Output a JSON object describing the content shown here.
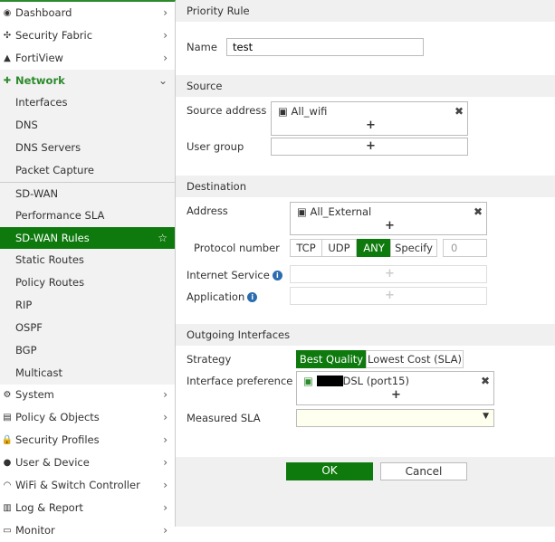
{
  "sidebar": {
    "items": [
      {
        "label": "Dashboard",
        "icon": "dashboard-icon",
        "chevron": "›"
      },
      {
        "label": "Security Fabric",
        "icon": "security-fabric-icon",
        "chevron": "›"
      },
      {
        "label": "FortiView",
        "icon": "fortiview-icon",
        "chevron": "›"
      },
      {
        "label": "Network",
        "icon": "network-icon",
        "chevron": "⌄"
      },
      {
        "label": "Interfaces"
      },
      {
        "label": "DNS"
      },
      {
        "label": "DNS Servers"
      },
      {
        "label": "Packet Capture"
      },
      {
        "label": "SD-WAN"
      },
      {
        "label": "Performance SLA"
      },
      {
        "label": "SD-WAN Rules",
        "star": "☆"
      },
      {
        "label": "Static Routes"
      },
      {
        "label": "Policy Routes"
      },
      {
        "label": "RIP"
      },
      {
        "label": "OSPF"
      },
      {
        "label": "BGP"
      },
      {
        "label": "Multicast"
      },
      {
        "label": "System",
        "icon": "gear-icon",
        "chevron": "›"
      },
      {
        "label": "Policy & Objects",
        "icon": "policy-icon",
        "chevron": "›"
      },
      {
        "label": "Security Profiles",
        "icon": "lock-icon",
        "chevron": "›"
      },
      {
        "label": "User & Device",
        "icon": "user-icon",
        "chevron": "›"
      },
      {
        "label": "WiFi & Switch Controller",
        "icon": "wifi-icon",
        "chevron": "›"
      },
      {
        "label": "Log & Report",
        "icon": "chart-icon",
        "chevron": "›"
      },
      {
        "label": "Monitor",
        "icon": "monitor-icon",
        "chevron": "›"
      }
    ]
  },
  "form": {
    "priority_rule": "Priority Rule",
    "name_label": "Name",
    "name_value": "test",
    "source": "Source",
    "source_address_label": "Source address",
    "source_address_value": "All_wifi",
    "user_group_label": "User group",
    "destination": "Destination",
    "address_label": "Address",
    "address_value": "All_External",
    "protocol_label": "Protocol number",
    "protocols": [
      "TCP",
      "UDP",
      "ANY",
      "Specify"
    ],
    "protocol_selected": "ANY",
    "protocol_number": "0",
    "internet_service_label": "Internet Service",
    "application_label": "Application",
    "outgoing": "Outgoing Interfaces",
    "strategy_label": "Strategy",
    "strategies": [
      "Best Quality",
      "Lowest Cost (SLA)"
    ],
    "strategy_selected": "Best Quality",
    "interface_pref_label": "Interface preference",
    "interface_value": "DSL (port15)",
    "measured_sla_label": "Measured SLA",
    "measured_sla_value": "",
    "plus": "+",
    "remove": "✖"
  },
  "buttons": {
    "ok": "OK",
    "cancel": "Cancel"
  },
  "colors": {
    "accent": "#0e7a0e"
  }
}
